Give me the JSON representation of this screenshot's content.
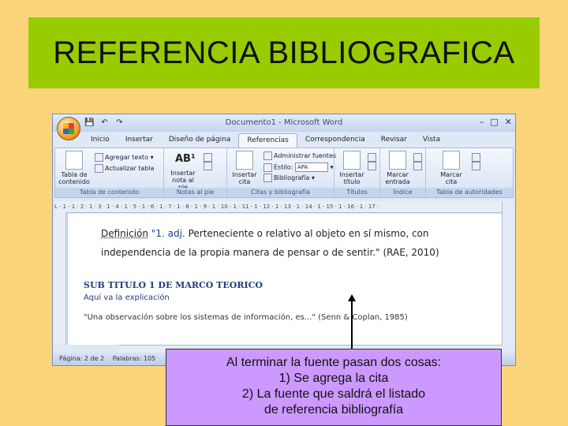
{
  "slide": {
    "title": "REFERENCIA BIBLIOGRAFICA",
    "callout": [
      "Al terminar la fuente pasan dos cosas:",
      "1)  Se agrega la cita",
      "2) La fuente que saldrá el listado",
      "de referencia bibliografía"
    ]
  },
  "word": {
    "window_title": "Documento1 - Microsoft Word",
    "tabs": [
      "Inicio",
      "Insertar",
      "Diseño de página",
      "Referencias",
      "Correspondencia",
      "Revisar",
      "Vista"
    ],
    "ribbon": {
      "toc_button": "Tabla de contenido",
      "add_text": "Agregar texto",
      "update_table": "Actualizar tabla",
      "toc_group": "Tabla de contenido",
      "insert_footnote": "Insertar nota al pie",
      "footnote_group": "Notas al pie",
      "insert_citation": "Insertar cita",
      "manage_sources": "Administrar fuentes",
      "style_label": "Estilo:",
      "style_value": "APA",
      "bibliography": "Bibliografía",
      "citations_group": "Citas y bibliografía",
      "insert_caption": "Insertar título",
      "captions_group": "Títulos",
      "mark_entry": "Marcar entrada",
      "index_group": "Índice",
      "mark_citation": "Marcar cita",
      "authorities_group": "Tabla de autoridades"
    },
    "ruler": "L · 1 · 1 · 2 · 1 · 3 · 1 · 4 · 1 · 5 · 1 · 6 · 1 · 7 · 1 · 8 · 1 · 9 · 1 · 10 · 1 · 11 · 1 · 12 · 1 · 13 · 1 · 14 · 1 · 15 · 1 · 16 · 1 · 17 ·",
    "document": {
      "def_label": "Definición",
      "def_quote": "\"1. adj.",
      "def_rest": "Perteneciente o relativo al objeto en sí mismo, con",
      "def_line2": "independencia de la propia manera de pensar o de sentir.\" (RAE, 2010)",
      "subtitle": "SUB TITULO 1 DE MARCO TEORICO",
      "aqui": "Aquí va la explicación",
      "obs": "\"Una observación sobre los sistemas de información, es...\" (Senn & Coplan, 1985)"
    },
    "status": {
      "page": "Página: 2 de 2",
      "words": "Palabras: 105"
    }
  }
}
